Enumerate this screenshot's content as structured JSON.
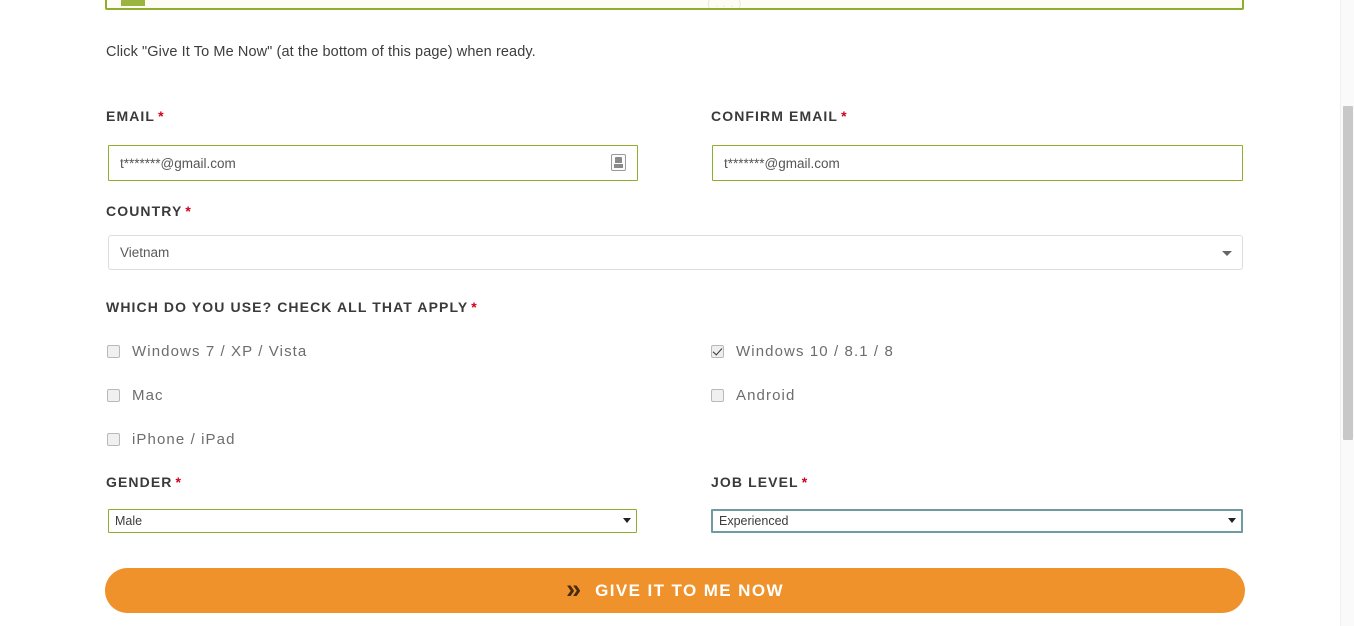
{
  "notice": {
    "clipped_text": "( . . . )"
  },
  "intro": {
    "text": "Click \"Give It To Me Now\" (at the bottom of this page) when ready."
  },
  "fields": {
    "email": {
      "label": "EMAIL",
      "required_mark": "*",
      "value": "t*******@gmail.com"
    },
    "confirm_email": {
      "label": "CONFIRM EMAIL",
      "required_mark": "*",
      "value": "t*******@gmail.com"
    },
    "country": {
      "label": "COUNTRY",
      "required_mark": "*",
      "value": "Vietnam"
    },
    "usage": {
      "label": "WHICH DO YOU USE? CHECK ALL THAT APPLY",
      "required_mark": "*",
      "options": [
        {
          "label": "Windows 7 / XP / Vista",
          "checked": false,
          "column": "left"
        },
        {
          "label": "Mac",
          "checked": false,
          "column": "left"
        },
        {
          "label": "iPhone / iPad",
          "checked": false,
          "column": "left"
        },
        {
          "label": "Windows 10 / 8.1 / 8",
          "checked": true,
          "column": "right"
        },
        {
          "label": "Android",
          "checked": false,
          "column": "right"
        }
      ]
    },
    "gender": {
      "label": "GENDER",
      "required_mark": "*",
      "value": "Male",
      "options": [
        "Male"
      ]
    },
    "job_level": {
      "label": "JOB LEVEL",
      "required_mark": "*",
      "value": "Experienced",
      "options": [
        "Experienced"
      ]
    }
  },
  "submit": {
    "label": "GIVE IT TO ME NOW",
    "icon": "double-chevron-right-icon",
    "glyph": "»",
    "color": "#f0922b"
  },
  "colors": {
    "accent_green": "#8fae2e",
    "required_red": "#d0021b",
    "focus_teal": "#6f9ba3",
    "button_orange": "#f0922b"
  }
}
